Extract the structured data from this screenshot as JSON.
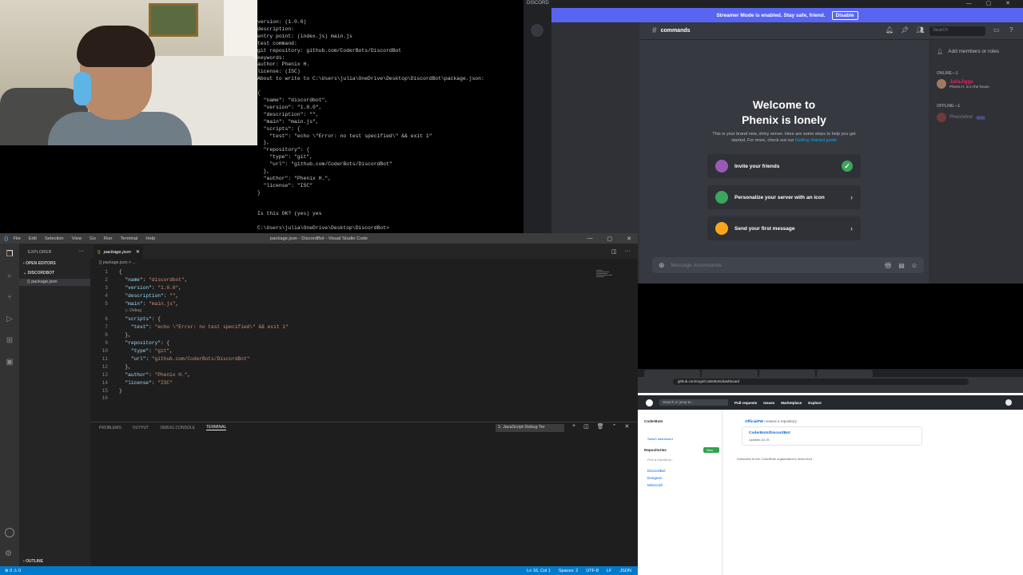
{
  "terminal": {
    "lines": [
      "version: (1.0.0)",
      "description:",
      "entry point: (index.js) main.js",
      "test command:",
      "git repository: github.com/CoderBots/DiscordBot",
      "keywords:",
      "author: Phenix H.",
      "license: (ISC)",
      "About to write to C:\\Users\\julia\\OneDrive\\Desktop\\DiscordBot\\package.json:",
      "",
      "{",
      "  \"name\": \"discordbot\",",
      "  \"version\": \"1.0.0\",",
      "  \"description\": \"\",",
      "  \"main\": \"main.js\",",
      "  \"scripts\": {",
      "    \"test\": \"echo \\\"Error: no test specified\\\" && exit 1\"",
      "  },",
      "  \"repository\": {",
      "    \"type\": \"git\",",
      "    \"url\": \"github.com/CoderBots/DiscordBot\"",
      "  },",
      "  \"author\": \"Phenix H.\",",
      "  \"license\": \"ISC\"",
      "}",
      "",
      "",
      "Is this OK? (yes) yes",
      "",
      "C:\\Users\\julia\\OneDrive\\Desktop\\DiscordBot>"
    ]
  },
  "discord": {
    "app_label": "DISCORD",
    "streamer_text": "Streamer Mode is enabled. Stay safe, friend.",
    "streamer_disable": "Disable",
    "channel": "commands",
    "search_placeholder": "Search",
    "welcome_title_line1": "Welcome to",
    "welcome_title_line2": "Phenix is lonely",
    "welcome_sub": "This is your brand new, shiny server. Here are some steps to help you get started. For more, check out our",
    "welcome_link": "Getting Started guide",
    "cards": [
      {
        "label": "Invite your friends",
        "done": true
      },
      {
        "label": "Personalize your server with an icon",
        "done": false
      },
      {
        "label": "Send your first message",
        "done": false
      }
    ],
    "message_placeholder": "Message #commands",
    "add_members": "Add members or roles",
    "online_header": "ONLINE—1",
    "offline_header": "OFFLINE—1",
    "online_member_name": "JuliaJigga",
    "online_member_status": "Phenix H. is in the house",
    "offline_member_name": "Phenixbot",
    "offline_member_tag": "BOT"
  },
  "vscode": {
    "menu": [
      "File",
      "Edit",
      "Selection",
      "View",
      "Go",
      "Run",
      "Terminal",
      "Help"
    ],
    "window_title": "package.json - DiscordBot - Visual Studio Code",
    "explorer_header": "EXPLORER",
    "open_editors": "OPEN EDITORS",
    "folder": "DISCORDBOT",
    "file": "package.json",
    "outline": "OUTLINE",
    "tab_label": "package.json",
    "breadcrumb": "{} package.json > ...",
    "codelens": "▷ Debug",
    "code_lines": [
      {
        "n": "1",
        "t": "{"
      },
      {
        "n": "2",
        "t": "  \"name\": \"discordbot\","
      },
      {
        "n": "3",
        "t": "  \"version\": \"1.0.0\","
      },
      {
        "n": "4",
        "t": "  \"description\": \"\","
      },
      {
        "n": "5",
        "t": "  \"main\": \"main.js\","
      },
      {
        "n": "6",
        "t": "  \"scripts\": {"
      },
      {
        "n": "7",
        "t": "    \"test\": \"echo \\\"Error: no test specified\\\" && exit 1\""
      },
      {
        "n": "8",
        "t": "  },"
      },
      {
        "n": "9",
        "t": "  \"repository\": {"
      },
      {
        "n": "10",
        "t": "    \"type\": \"git\","
      },
      {
        "n": "11",
        "t": "    \"url\": \"github.com/CoderBots/DiscordBot\""
      },
      {
        "n": "12",
        "t": "  },"
      },
      {
        "n": "13",
        "t": "  \"author\": \"Phenix H.\","
      },
      {
        "n": "14",
        "t": "  \"license\": \"ISC\""
      },
      {
        "n": "15",
        "t": "}"
      },
      {
        "n": "16",
        "t": ""
      }
    ],
    "panel_tabs": [
      "PROBLEMS",
      "OUTPUT",
      "DEBUG CONSOLE",
      "TERMINAL"
    ],
    "terminal_select": "1: JavaScript Debug Ter",
    "status_left": "⊗ 0  ⚠ 0",
    "status_right": [
      "Ln 16, Col 1",
      "Spaces: 2",
      "UTF-8",
      "LF",
      "JSON"
    ]
  },
  "github": {
    "url": "github.com/orgs/CoderBots/dashboard",
    "search": "Search or jump to...",
    "nav": [
      "Pull requests",
      "Issues",
      "Marketplace",
      "Explore"
    ],
    "org": "CoderBots",
    "switch": "Switch dashboard",
    "repos_title": "Repositories",
    "new_btn": "New",
    "find_repo": "Find a repository...",
    "repos": [
      "DiscordBot",
      "Dungeon",
      "Minecraft"
    ],
    "feed_user": "OfficialPW",
    "feed_action": "created a repository",
    "repo_full": "CoderBots/DiscordBot",
    "repo_updated": "Updated Jul 25",
    "subscribe_text": "Subscribe to the CoderBots organization's news feed"
  },
  "colors": {
    "discord_blurple": "#5865f2",
    "vscode_blue": "#007acc",
    "github_green": "#2ea44f"
  }
}
